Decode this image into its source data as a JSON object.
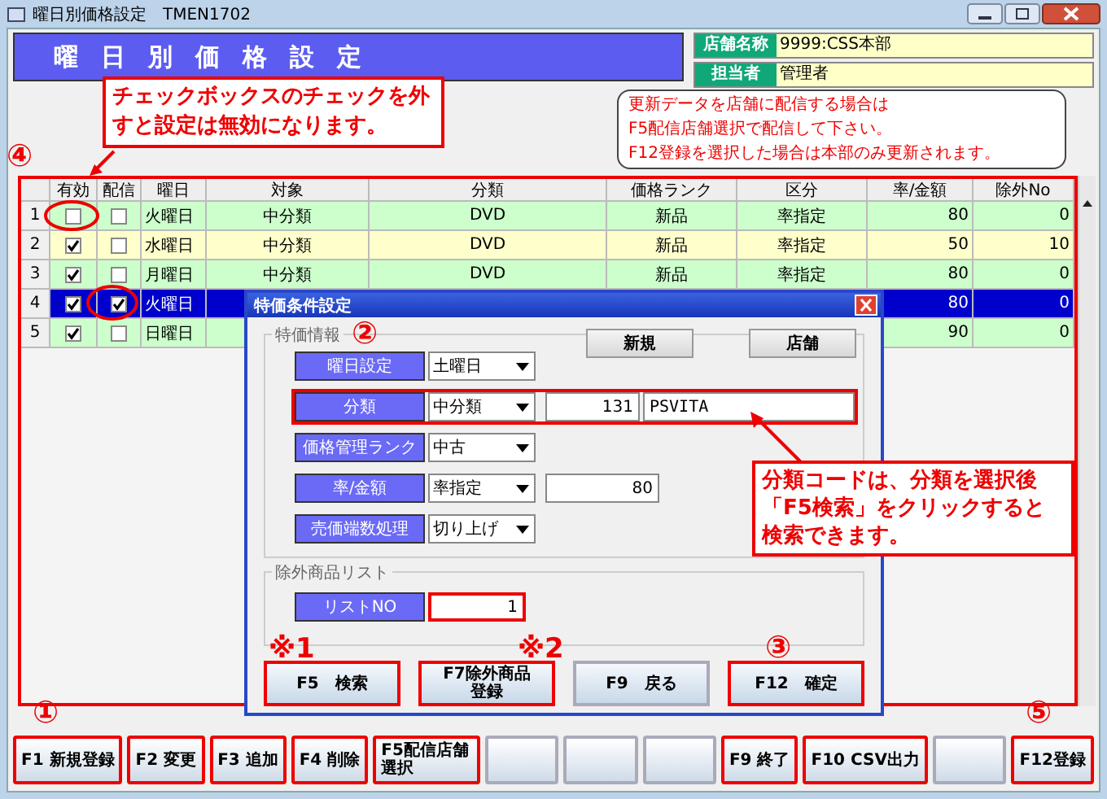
{
  "window": {
    "title": "曜日別価格設定　TMEN1702"
  },
  "header": {
    "title": "曜日別価格設定",
    "fields": [
      {
        "label": "店舗名称",
        "value": "9999:CSS本部"
      },
      {
        "label": "担当者",
        "value": "管理者"
      }
    ]
  },
  "notice": [
    "更新データを店舗に配信する場合は",
    "F5配信店舗選択で配信して下さい。",
    "F12登録を選択した場合は本部のみ更新されます。"
  ],
  "table": {
    "highlighted": true,
    "columns": [
      "有効",
      "配信",
      "曜日",
      "対象",
      "分類",
      "価格ランク",
      "区分",
      "率/金額",
      "除外No"
    ],
    "rows": [
      {
        "no": "1",
        "enabled": false,
        "distribute": false,
        "day": "火曜日",
        "target": "中分類",
        "category": "DVD",
        "rank": "新品",
        "division": "率指定",
        "amount": "80",
        "exclude": "0",
        "color": "#ccffcc",
        "selected": false
      },
      {
        "no": "2",
        "enabled": true,
        "distribute": false,
        "day": "水曜日",
        "target": "中分類",
        "category": "DVD",
        "rank": "新品",
        "division": "率指定",
        "amount": "50",
        "exclude": "10",
        "color": "#ffffcc",
        "selected": false
      },
      {
        "no": "3",
        "enabled": true,
        "distribute": false,
        "day": "月曜日",
        "target": "中分類",
        "category": "DVD",
        "rank": "新品",
        "division": "率指定",
        "amount": "80",
        "exclude": "0",
        "color": "#ccffcc",
        "selected": false
      },
      {
        "no": "4",
        "enabled": true,
        "distribute": true,
        "day": "火曜日",
        "amount": "80",
        "exclude": "0",
        "selected": true
      },
      {
        "no": "5",
        "enabled": true,
        "distribute": false,
        "day": "日曜日",
        "amount": "90",
        "exclude": "0",
        "color": "#ccffcc",
        "selected": false
      }
    ]
  },
  "dialog": {
    "title": "特価条件設定",
    "group": "特価情報",
    "top_buttons": [
      "新規",
      "店舗"
    ],
    "fields": [
      {
        "label": "曜日設定",
        "kind": "combo",
        "value": "土曜日"
      },
      {
        "label": "分類",
        "kind": "combo_code",
        "value": "中分類",
        "code": "131",
        "name": "PSVITA",
        "highlighted": true
      },
      {
        "label": "価格管理ランク",
        "kind": "combo",
        "value": "中古"
      },
      {
        "label": "率/金額",
        "kind": "combo_number",
        "value": "率指定",
        "number": "80"
      },
      {
        "label": "売価端数処理",
        "kind": "combo",
        "value": "切り上げ"
      }
    ],
    "exclude_group": "除外商品リスト",
    "exclude_field": {
      "label": "リストNO",
      "value": "1",
      "highlighted": true
    },
    "buttons": [
      {
        "label": "F5　検索",
        "highlighted": true
      },
      {
        "label": "F7除外商品登録",
        "highlighted": true
      },
      {
        "label": "F9　戻る",
        "highlighted": false
      },
      {
        "label": "F12　確定",
        "highlighted": true
      }
    ]
  },
  "function_keys": [
    {
      "kind": "key",
      "label": "F1 新規登録",
      "highlighted": true
    },
    {
      "kind": "key",
      "label": "F2 変更",
      "highlighted": true
    },
    {
      "kind": "key",
      "label": "F3 追加",
      "highlighted": true
    },
    {
      "kind": "key",
      "label": "F4 削除",
      "highlighted": true
    },
    {
      "kind": "two_line_key",
      "label": "F5配信店舗選択",
      "highlighted": true
    },
    {
      "kind": "blank"
    },
    {
      "kind": "blank"
    },
    {
      "kind": "blank"
    },
    {
      "kind": "key",
      "label": "F9 終了",
      "highlighted": true
    },
    {
      "kind": "key",
      "label": "F10 CSV出力",
      "highlighted": true
    },
    {
      "kind": "blank"
    },
    {
      "kind": "key",
      "label": "F12登録",
      "highlighted": true
    }
  ],
  "annotations": {
    "callouts": [
      "チェックボックスのチェックを外すと設定は無効になります。",
      "分類コードは、分類を選択後「F5検索」をクリックすると検索できます。"
    ],
    "numbers": [
      "④",
      "②",
      "①",
      "⑤",
      "③"
    ],
    "notes": [
      "※1",
      "※2"
    ]
  }
}
